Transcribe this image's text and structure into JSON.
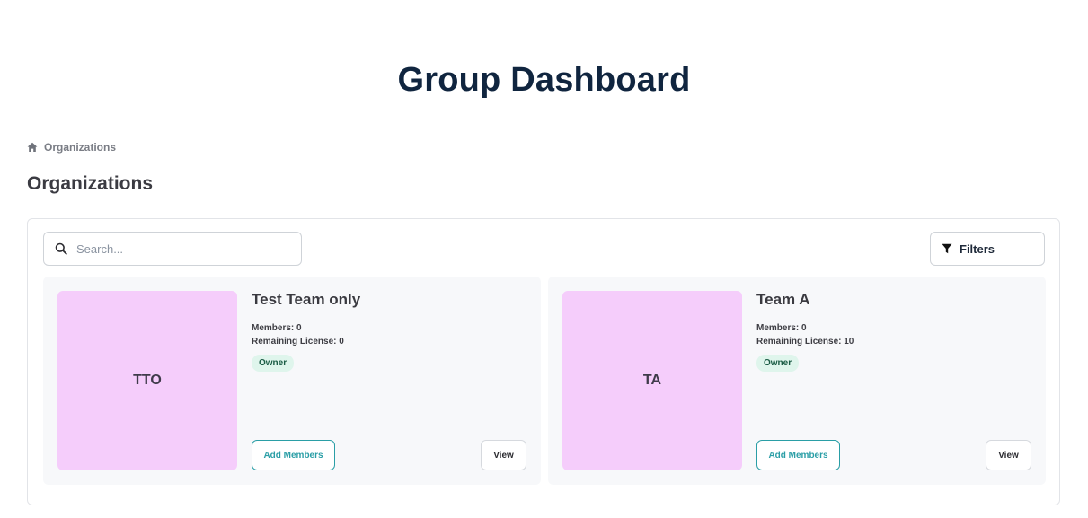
{
  "page": {
    "title": "Group Dashboard"
  },
  "breadcrumb": {
    "icon": "home-icon",
    "items": [
      "Organizations"
    ]
  },
  "section": {
    "title": "Organizations"
  },
  "search": {
    "placeholder": "Search...",
    "value": "",
    "icon": "search-icon"
  },
  "filters": {
    "label": "Filters",
    "icon": "filter-icon"
  },
  "organizations": [
    {
      "initials": "TTO",
      "name": "Test Team only",
      "members": "Members: 0",
      "remaining_license": "Remaining License: 0",
      "role": "Owner",
      "add_members_label": "Add Members",
      "view_label": "View"
    },
    {
      "initials": "TA",
      "name": "Team A",
      "members": "Members: 0",
      "remaining_license": "Remaining License: 10",
      "role": "Owner",
      "add_members_label": "Add Members",
      "view_label": "View"
    }
  ],
  "colors": {
    "title": "#10253f",
    "accent": "#2a9ea6",
    "avatar_bg": "#f5cdfb",
    "badge_bg": "#dff5ec",
    "card_bg": "#f7f8fa"
  }
}
